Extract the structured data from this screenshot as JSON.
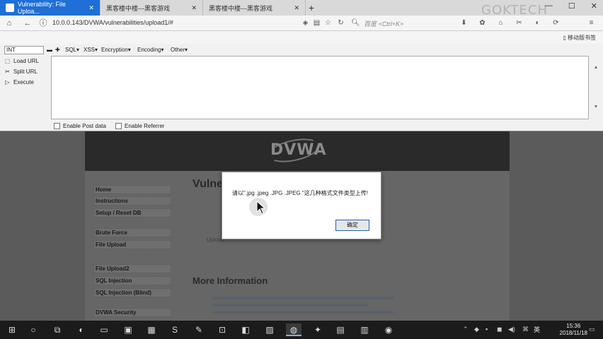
{
  "tabs": [
    {
      "label": "Vulnerability: File Uploa...",
      "active": true
    },
    {
      "label": "黑客楼中楼---黑客游戏",
      "active": false
    },
    {
      "label": "黑客楼中楼---黑客游戏",
      "active": false
    }
  ],
  "new_tab_symbol": "+",
  "watermark": "GOKTECH",
  "address": {
    "url": "10.0.0.143/DVWA/vulnerabilities/upload1/#",
    "search_placeholder": "百度 <Ctrl+K>"
  },
  "bookmarks": {
    "mobile_label": "移动版书签"
  },
  "hackbar": {
    "select_value": "INT",
    "menus": [
      "SQL▾",
      "XSS▾",
      "Encryption▾",
      "Encoding▾",
      "Other▾"
    ],
    "actions": [
      {
        "label": "Load URL",
        "icon": "load-url-icon"
      },
      {
        "label": "Split URL",
        "icon": "split-url-icon"
      },
      {
        "label": "Execute",
        "icon": "execute-icon"
      }
    ],
    "post_data_label": "Enable Post data",
    "referrer_label": "Enable Referrer"
  },
  "dvwa": {
    "logo": "DVWA",
    "title": "Vulne",
    "menu_items": [
      "Home",
      "Instructions",
      "Setup / Reset DB",
      "Brute Force",
      "File Upload",
      "File Upload2",
      "SQL Injection",
      "SQL Injection (Blind)",
      "DVWA Security"
    ],
    "upload_label": "Upload",
    "more_info": "More Information"
  },
  "dialog": {
    "message": "请以\".jpg .jpeg .JPG .JPEG \"这几种格式文件类型上传!",
    "ok_label": "确定"
  },
  "taskbar": {
    "ime": "英",
    "time": "15:36",
    "date": "2018/11/18"
  }
}
